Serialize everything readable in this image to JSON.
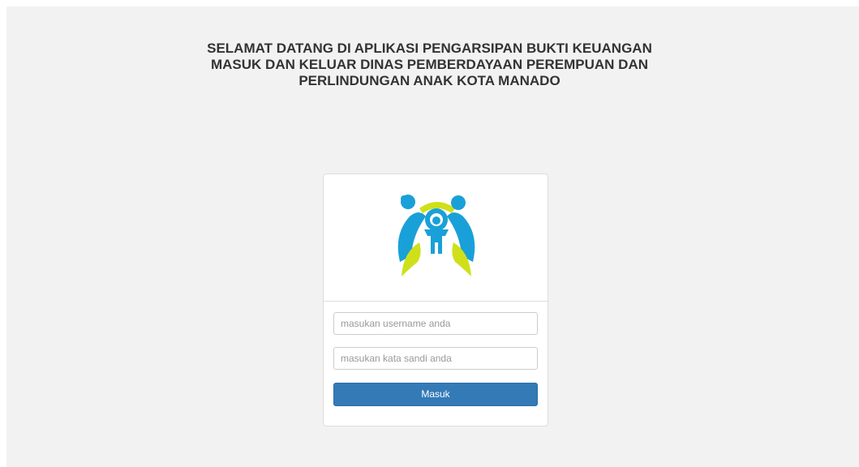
{
  "header": {
    "title_lines": [
      "SELAMAT DATANG DI APLIKASI PENGARSIPAN BUKTI KEUANGAN",
      "MASUK DAN KELUAR DINAS PEMBERDAYAAN PEREMPUAN DAN",
      "PERLINDUNGAN ANAK KOTA MANADO"
    ]
  },
  "login": {
    "logo_icon": "kemenpppa-logo-icon",
    "username_placeholder": "masukan username anda",
    "password_placeholder": "masukan kata sandi anda",
    "submit_label": "Masuk"
  },
  "colors": {
    "background": "#f2f2f2",
    "button": "#337ab7",
    "logo_blue": "#1aa0d8",
    "logo_yellow": "#cfe01a"
  }
}
